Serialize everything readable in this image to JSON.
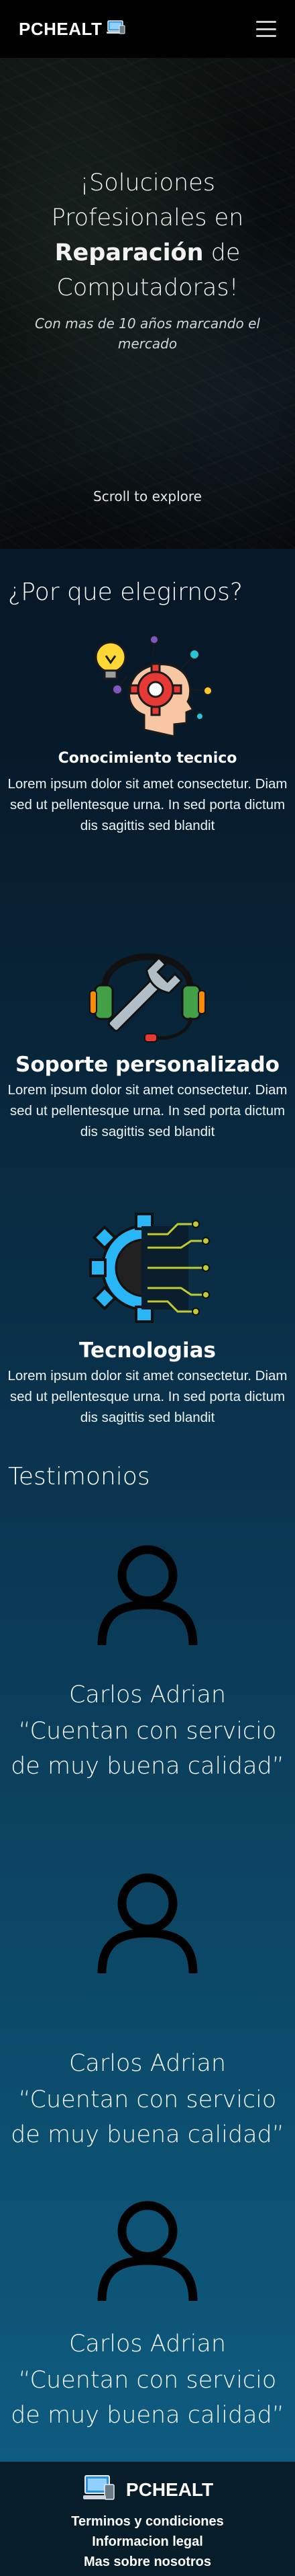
{
  "navbar": {
    "brand": "PCHEALT",
    "logo_icon": "laptop-icon",
    "menu_icon": "hamburger-icon"
  },
  "hero": {
    "title_line1": "¡Soluciones",
    "title_line2": "Profesionales en",
    "title_bold": "Reparación",
    "title_after_bold": " de",
    "title_line4": "Computadoras!",
    "subtitle": "Con mas de 10 años marcando el mercado",
    "scroll_hint": "Scroll to explore"
  },
  "why": {
    "title": "¿Por que elegirnos?",
    "features": [
      {
        "icon": "brain-gear-icon",
        "title": "Conocimiento tecnico",
        "text": "Lorem ipsum dolor sit amet consectetur. Diam sed ut pellentesque urna. In sed porta dictum dis sagittis sed blandit"
      },
      {
        "icon": "headset-wrench-icon",
        "title": "Soporte personalizado",
        "text": "Lorem ipsum dolor sit amet consectetur. Diam sed ut pellentesque urna. In sed porta dictum dis sagittis sed blandit"
      },
      {
        "icon": "gear-circuit-icon",
        "title": "Tecnologias",
        "text": "Lorem ipsum dolor sit amet consectetur. Diam sed ut pellentesque urna. In sed porta dictum dis sagittis sed blandit"
      }
    ]
  },
  "testimonials": {
    "title": "Testimonios",
    "items": [
      {
        "icon": "user-icon",
        "name": "Carlos Adrian",
        "quote": "“Cuentan con servicio de muy buena calidad”"
      },
      {
        "icon": "user-icon",
        "name": "Carlos Adrian",
        "quote": "“Cuentan con servicio de muy buena calidad”"
      },
      {
        "icon": "user-icon",
        "name": "Carlos Adrian",
        "quote": "“Cuentan con servicio de muy buena calidad”"
      }
    ]
  },
  "footer": {
    "brand": "PCHEALT",
    "logo_icon": "laptop-icon",
    "links": [
      "Terminos y condiciones",
      "Informacion legal",
      "Mas sobre nosotros"
    ]
  },
  "colors": {
    "nav_bg": "#000000",
    "footer_bg": "#071d29",
    "accent_cyan": "#4fc3f7",
    "gear_red": "#e53935"
  }
}
